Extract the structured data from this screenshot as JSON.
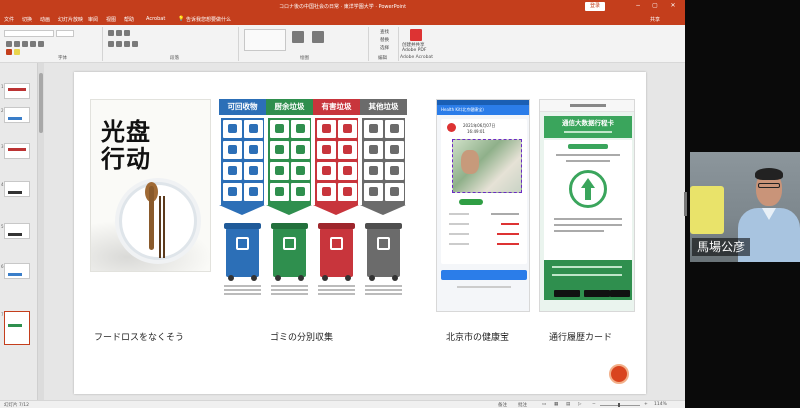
{
  "window": {
    "title": "コロナ後の中国社会の日常 · 東洋学園大学 · PowerPoint",
    "signin_label": "登录",
    "minimize": "−",
    "restore": "▢",
    "close": "✕"
  },
  "menu": {
    "tabs": [
      "文件",
      "切换",
      "动画",
      "幻灯片放映",
      "审阅",
      "视图",
      "帮助",
      "Acrobat"
    ],
    "search_hint": "告诉我您想要做什么",
    "share_label": "共享"
  },
  "ribbon": {
    "groups": [
      "字体",
      "段落",
      "绘图",
      "编辑",
      "Adobe Acrobat"
    ],
    "buttons": {
      "find": "查找",
      "replace": "替换",
      "select": "选择",
      "create_pdf": "创建并共享 Adobe PDF"
    }
  },
  "slides": {
    "numbers": [
      "1",
      "2",
      "3",
      "4",
      "5",
      "6",
      "7"
    ],
    "selected_index": 6
  },
  "slide": {
    "poster1": {
      "characters": [
        "光盘",
        "行动"
      ]
    },
    "poster2": {
      "columns": [
        {
          "label": "可回收物",
          "color": "#2c6fb7"
        },
        {
          "label": "厨余垃圾",
          "color": "#2f8f4e"
        },
        {
          "label": "有害垃圾",
          "color": "#c8353c"
        },
        {
          "label": "其他垃圾",
          "color": "#6b6b6b"
        }
      ]
    },
    "phone1": {
      "header": "Health Kit(北京健康宝)",
      "date": "2021年06月07日",
      "time": "16:49:01"
    },
    "phone2": {
      "header": "通信大数据行程卡"
    },
    "captions": {
      "food": "フードロスをなくそう",
      "garbage": "ゴミの分別収集",
      "health": "北京市の健康宝",
      "travel": "通行履歴カード"
    }
  },
  "statusbar": {
    "slide_info": "幻灯片 7/12",
    "notes": "备注",
    "comments": "批注",
    "zoom": "114%"
  },
  "video": {
    "participant_name": "馬場公彦"
  }
}
